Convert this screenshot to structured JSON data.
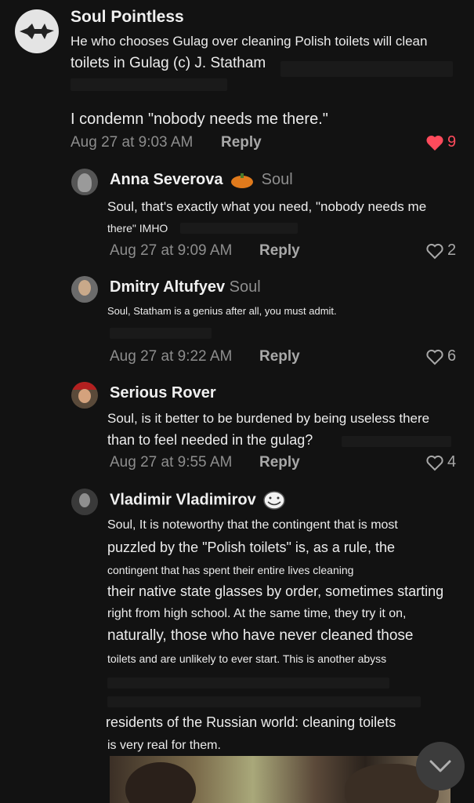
{
  "comments": [
    {
      "author": "Soul Pointless",
      "lines": [
        "He who chooses Gulag over cleaning Polish toilets will clean",
        "toilets in Gulag (c) J. Statham",
        "I condemn \"nobody needs me there.\""
      ],
      "time": "Aug 27 at 9:03 AM",
      "reply": "Reply",
      "likes": "9",
      "liked": true
    },
    {
      "author": "Anna Severova",
      "tag": "Soul",
      "lines": [
        "Soul, that's exactly what you need, \"nobody needs me",
        "there\" IMHO"
      ],
      "time": "Aug 27 at 9:09 AM",
      "reply": "Reply",
      "likes": "2"
    },
    {
      "author": "Dmitry Altufyev",
      "tag": "Soul",
      "lines": [
        "Soul, Statham is a genius after all, you must admit."
      ],
      "time": "Aug 27 at 9:22 AM",
      "reply": "Reply",
      "likes": "6"
    },
    {
      "author": "Serious Rover",
      "lines": [
        "Soul, is it better to be burdened by being useless there",
        "than to feel needed in the gulag?"
      ],
      "time": "Aug 27 at 9:55 AM",
      "reply": "Reply",
      "likes": "4"
    },
    {
      "author": "Vladimir Vladimirov",
      "lines": [
        "Soul, It is noteworthy that the contingent that is most",
        "puzzled by the \"Polish toilets\" is, as a rule, the",
        "contingent that has spent their entire lives cleaning",
        "their native state glasses by order, sometimes starting",
        "right from high school. At the same time, they try it on,",
        "naturally, those who have never cleaned those",
        "toilets and are unlikely to ever start. This is another abyss",
        "residents of the Russian world: cleaning toilets",
        "is very real for them."
      ]
    }
  ],
  "colors": {
    "background": "#121212",
    "liked": "#ff4b5c",
    "muted": "#8d8d8d"
  },
  "icons": {
    "jet": "jet-icon",
    "heart_filled": "heart-filled-icon",
    "heart_outline": "heart-outline-icon",
    "scroll_down": "chevron-down-icon"
  }
}
